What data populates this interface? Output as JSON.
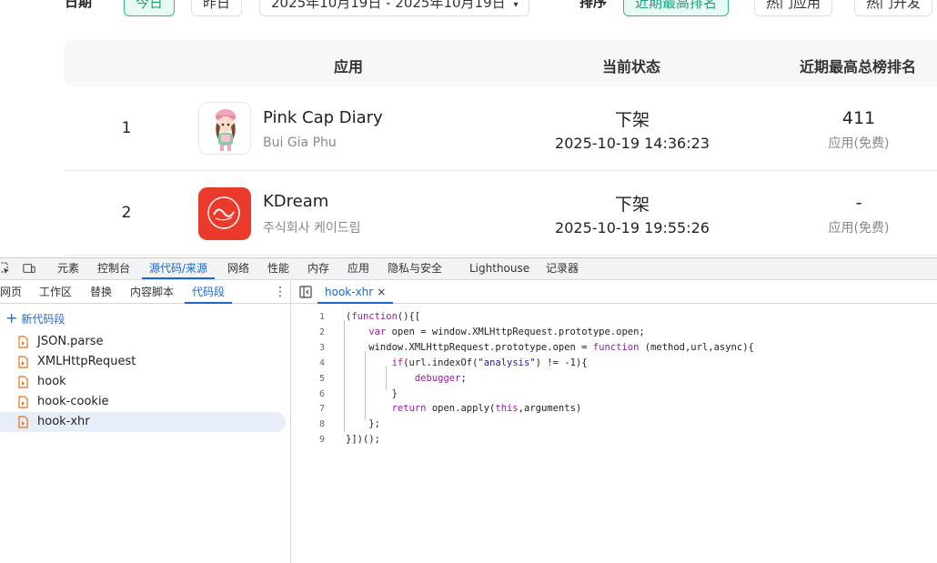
{
  "filter": {
    "date_label": "日期",
    "today": "今日",
    "yesterday": "昨日",
    "date_range": "2025年10月19日 - 2025年10月19日",
    "sort_label": "排序",
    "sort_recent_high": "近期最高排名",
    "sort_hot_apps": "热门应用",
    "sort_hot_dev": "热门开发"
  },
  "table": {
    "headers": {
      "app": "应用",
      "status": "当前状态",
      "rank": "近期最高总榜排名"
    },
    "rows": [
      {
        "index": "1",
        "name": "Pink Cap Diary",
        "developer": "Bui Gia Phu",
        "status": "下架",
        "time": "2025-10-19 14:36:23",
        "rank": "411",
        "category": "应用(免费)",
        "icon": "pink-cap-girl-icon"
      },
      {
        "index": "2",
        "name": "KDream",
        "developer": "주식회사 케이드림",
        "status": "下架",
        "time": "2025-10-19 19:55:26",
        "rank": "-",
        "category": "应用(免费)",
        "icon": "kdream-logo-icon"
      }
    ]
  },
  "devtools": {
    "tabs": [
      "元素",
      "控制台",
      "源代码/来源",
      "网络",
      "性能",
      "内存",
      "应用",
      "隐私与安全",
      "Lighthouse",
      "记录器"
    ],
    "active_tab": "源代码/来源",
    "sub_tabs": [
      "网页",
      "工作区",
      "替换",
      "内容脚本",
      "代码段"
    ],
    "active_sub_tab": "代码段",
    "new_snippet": "新代码段",
    "snippets": [
      "JSON.parse",
      "XMLHttpRequest",
      "hook",
      "hook-cookie",
      "hook-xhr"
    ],
    "selected_snippet": "hook-xhr",
    "open_file": "hook-xhr",
    "close_glyph": "×",
    "code_lines": [
      {
        "n": "1",
        "text": "(function(){["
      },
      {
        "n": "2",
        "text": "    var open = window.XMLHttpRequest.prototype.open;"
      },
      {
        "n": "3",
        "text": "    window.XMLHttpRequest.prototype.open = function (method,url,async){"
      },
      {
        "n": "4",
        "text": "        if(url.indexOf(\"analysis\") != -1){"
      },
      {
        "n": "5",
        "text": "            debugger;"
      },
      {
        "n": "6",
        "text": "        }"
      },
      {
        "n": "7",
        "text": "        return open.apply(this,arguments)"
      },
      {
        "n": "8",
        "text": "    };"
      },
      {
        "n": "9",
        "text": "}])();"
      }
    ],
    "colors": {
      "accent": "#1a67d2",
      "keyword": "#9a1aa5",
      "string": "#1a1aa6"
    }
  }
}
